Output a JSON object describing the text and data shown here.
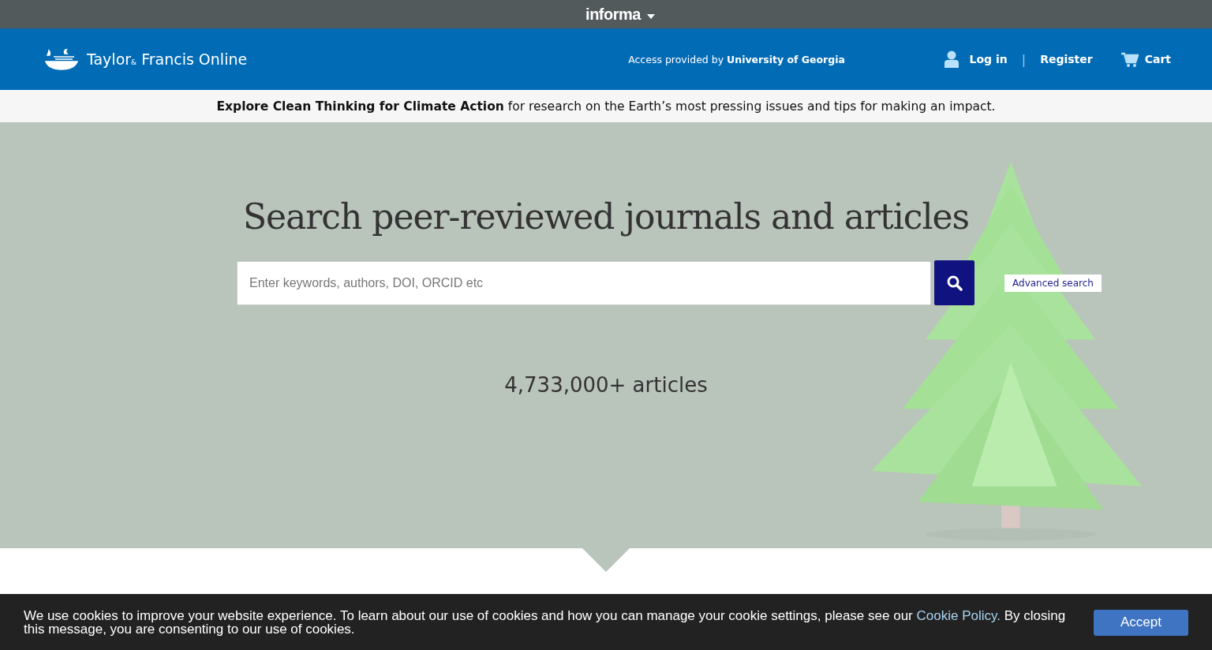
{
  "top_bar": {
    "brand": "informa"
  },
  "header": {
    "logo": "Taylor$_{&}$ Francis Online",
    "access": "Access provided by **University of Georgia**",
    "login": "Log in",
    "separator": "|",
    "register": "Register",
    "cart": "Cart"
  },
  "announcement": "**Explore Clean Thinking for Climate Action** for research on the Earth’s most pressing issues and tips for making an impact.",
  "hero": {
    "title": "Search peer-reviewed journals and articles",
    "search": {
      "placeholder": "Enter keywords, authors, DOI, ORCID etc"
    },
    "advanced_search": "Advanced search",
    "count": "4,733,000+ articles"
  },
  "cookie_notice": {
    "text_before": "We use cookies to improve your website experience. To learn about our use of cookies and how you can manage your cookie settings, please see our ",
    "link": "Cookie Policy.",
    "text_after": " By closing this message, you are consenting to our use of cookies.",
    "button": "Accept"
  }
}
